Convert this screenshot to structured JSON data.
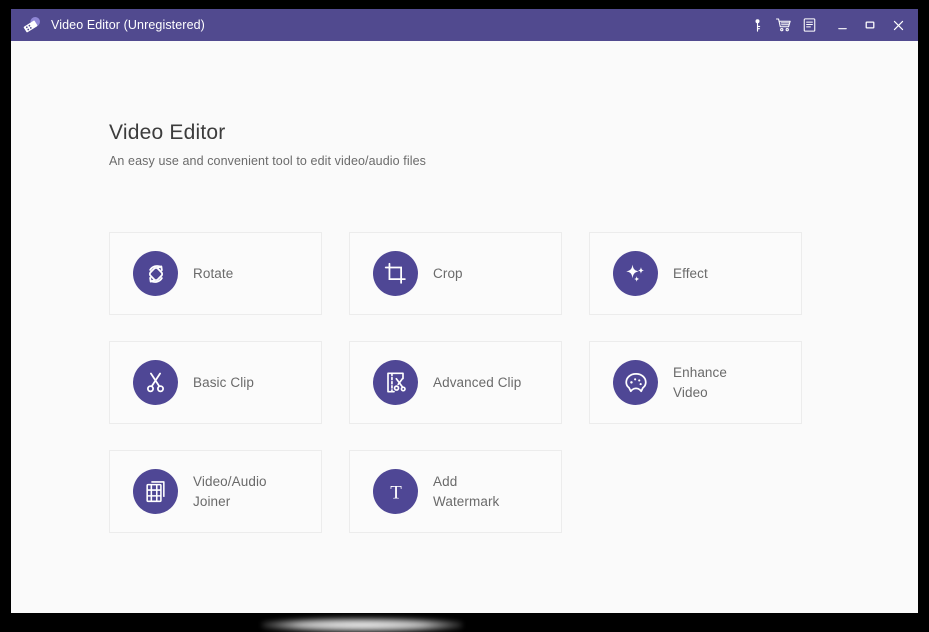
{
  "window": {
    "titlebar": {
      "logo_icon": "video-editor-logo-icon",
      "title": "Video Editor (Unregistered)",
      "actions": [
        {
          "name": "register-key-button",
          "icon": "key-icon",
          "label": "Register"
        },
        {
          "name": "buy-cart-button",
          "icon": "shopping-cart-icon",
          "label": "Buy"
        },
        {
          "name": "menu-list-button",
          "icon": "list-menu-icon",
          "label": "Menu"
        }
      ],
      "controls": [
        {
          "name": "minimize-button",
          "icon": "minimize-icon",
          "label": "Minimize"
        },
        {
          "name": "maximize-button",
          "icon": "maximize-icon",
          "label": "Maximize"
        },
        {
          "name": "close-button",
          "icon": "close-icon",
          "label": "Close"
        }
      ]
    },
    "page": {
      "title": "Video Editor",
      "subtitle": "An easy use and convenient tool to edit video/audio files"
    },
    "tools": [
      {
        "label": "Rotate",
        "icon": "rotate-icon"
      },
      {
        "label": "Crop",
        "icon": "crop-icon"
      },
      {
        "label": "Effect",
        "icon": "sparkles-effect-icon"
      },
      {
        "label": "Basic Clip",
        "icon": "scissors-icon"
      },
      {
        "label": "Advanced Clip",
        "icon": "advanced-scissors-icon"
      },
      {
        "label": "Enhance\nVideo",
        "icon": "palette-icon"
      },
      {
        "label": "Video/Audio\nJoiner",
        "icon": "film-strip-join-icon"
      },
      {
        "label": "Add\nWatermark",
        "icon": "text-watermark-icon"
      }
    ],
    "colors": {
      "titlebar": "#514a8f",
      "icon_circle": "#4f4795",
      "content_background": "#fafafa",
      "card_background": "#fbfbfb",
      "card_border": "#ececec",
      "label_text": "#6a6a6a",
      "title_text": "#3c3c3c"
    }
  }
}
